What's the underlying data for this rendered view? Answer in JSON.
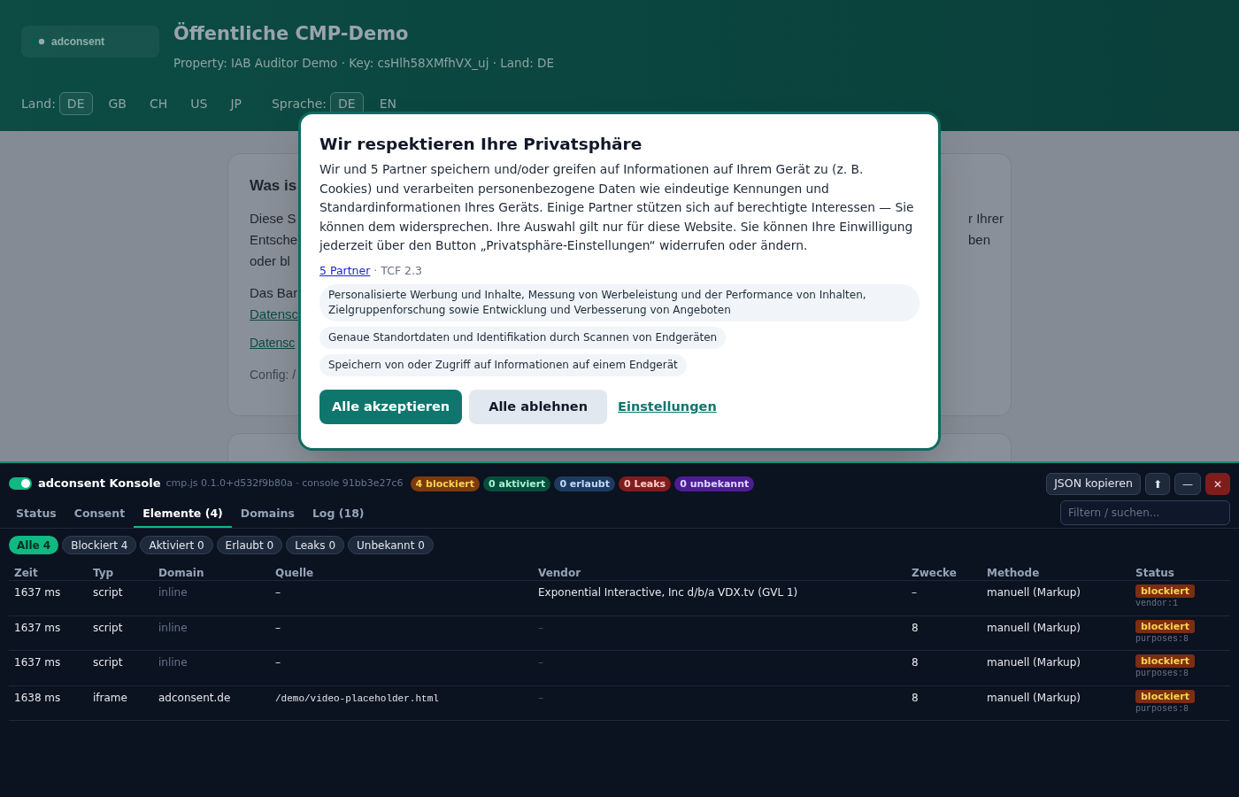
{
  "header": {
    "logo_text": "adconsent",
    "title": "Öffentliche CMP-Demo",
    "subtitle": "Property: IAB Auditor Demo · Key: csHlh58XMfhVX_uj · Land: DE",
    "country_label": "Land:",
    "countries": [
      {
        "label": "DE",
        "selected": true
      },
      {
        "label": "GB",
        "selected": false
      },
      {
        "label": "CH",
        "selected": false
      },
      {
        "label": "US",
        "selected": false
      },
      {
        "label": "JP",
        "selected": false
      }
    ],
    "language_label": "Sprache:",
    "languages": [
      {
        "label": "DE",
        "selected": true
      },
      {
        "label": "EN",
        "selected": false
      }
    ]
  },
  "background_card": {
    "title": "Was is",
    "left_lines": [
      "Diese S",
      "Entsche",
      "oder bl"
    ],
    "right_lines": [
      "r Ihrer",
      "ben"
    ],
    "line_4": "Das Bar",
    "link_1": "Datensc",
    "link_2": "Datensc",
    "config": "Config: /"
  },
  "modal": {
    "title": "Wir respektieren Ihre Privatsphäre",
    "body": "Wir und 5 Partner speichern und/oder greifen auf Informationen auf Ihrem Gerät zu (z. B. Cookies) und verarbeiten personenbezogene Daten wie eindeutige Kennungen und Standardinformationen Ihres Geräts. Einige Partner stützen sich auf berechtigte Interessen — Sie können dem widersprechen. Ihre Auswahl gilt nur für diese Website. Sie können Ihre Einwilligung jederzeit über den Button „Privatsphäre-Einstellungen“ widerrufen oder ändern.",
    "partners_link": "5 Partner",
    "tcf": "· TCF 2.3",
    "purposes": [
      "Personalisierte Werbung und Inhalte, Messung von Werbeleistung und der Performance von Inhalten, Zielgruppenforschung sowie Entwicklung und Verbesserung von Angeboten",
      "Genaue Standortdaten und Identifikation durch Scannen von Endgeräten",
      "Speichern von oder Zugriff auf Informationen auf einem Endgerät"
    ],
    "accept": "Alle akzeptieren",
    "reject": "Alle ablehnen",
    "settings": "Einstellungen"
  },
  "console": {
    "enabled": true,
    "title": "adconsent Konsole",
    "version": "cmp.js 0.1.0+d532f9b80a · console 91bb3e27c6",
    "badges": [
      {
        "label": "4 blockiert",
        "kind": "blocked"
      },
      {
        "label": "0 aktiviert",
        "kind": "activated"
      },
      {
        "label": "0 erlaubt",
        "kind": "allowed"
      },
      {
        "label": "0 Leaks",
        "kind": "leak"
      },
      {
        "label": "0 unbekannt",
        "kind": "unknown"
      }
    ],
    "copy_button": "JSON kopieren",
    "up_button": "⬆",
    "minimize_button": "—",
    "close_button": "✕",
    "tabs": [
      {
        "label": "Status",
        "selected": false
      },
      {
        "label": "Consent",
        "selected": false
      },
      {
        "label": "Elemente (4)",
        "selected": true
      },
      {
        "label": "Domains",
        "selected": false
      },
      {
        "label": "Log (18)",
        "selected": false
      }
    ],
    "search": {
      "placeholder": "Filtern / suchen..."
    },
    "filters": [
      {
        "label": "Alle 4",
        "selected": true
      },
      {
        "label": "Blockiert 4",
        "selected": false
      },
      {
        "label": "Aktiviert 0",
        "selected": false
      },
      {
        "label": "Erlaubt 0",
        "selected": false
      },
      {
        "label": "Leaks 0",
        "selected": false
      },
      {
        "label": "Unbekannt 0",
        "selected": false
      }
    ],
    "table": {
      "columns": [
        "Zeit",
        "Typ",
        "Domain",
        "Quelle",
        "Vendor",
        "Zwecke",
        "Methode",
        "Status"
      ],
      "rows": [
        {
          "time": "1637 ms",
          "type": "script",
          "domain": "inline",
          "domain_muted": true,
          "source": "–",
          "source_code": false,
          "vendor": "Exponential Interactive, Inc d/b/a VDX.tv (GVL 1)",
          "vendor_muted": false,
          "purposes": "–",
          "method": "manuell (Markup)",
          "status": "blockiert",
          "status_detail": "vendor:1"
        },
        {
          "time": "1637 ms",
          "type": "script",
          "domain": "inline",
          "domain_muted": true,
          "source": "–",
          "source_code": false,
          "vendor": "–",
          "vendor_muted": true,
          "purposes": "8",
          "method": "manuell (Markup)",
          "status": "blockiert",
          "status_detail": "purposes:8"
        },
        {
          "time": "1637 ms",
          "type": "script",
          "domain": "inline",
          "domain_muted": true,
          "source": "–",
          "source_code": false,
          "vendor": "–",
          "vendor_muted": true,
          "purposes": "8",
          "method": "manuell (Markup)",
          "status": "blockiert",
          "status_detail": "purposes:8"
        },
        {
          "time": "1638 ms",
          "type": "iframe",
          "domain": "adconsent.de",
          "domain_muted": false,
          "source": "/demo/video-placeholder.html",
          "source_code": true,
          "vendor": "–",
          "vendor_muted": true,
          "purposes": "8",
          "method": "manuell (Markup)",
          "status": "blockiert",
          "status_detail": "purposes:8"
        }
      ]
    }
  }
}
